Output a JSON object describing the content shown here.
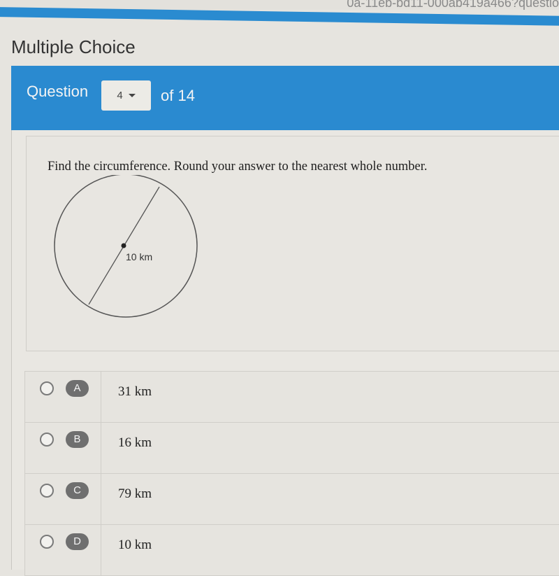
{
  "browser": {
    "url_fragment": "0a-11eb-bd11-000ab419a466?questio"
  },
  "page": {
    "title": "Multiple Choice"
  },
  "question_nav": {
    "label": "Question",
    "current": "4",
    "total_text": "of 14"
  },
  "question": {
    "prompt": "Find the circumference. Round your answer to the nearest whole number.",
    "figure": {
      "shape": "circle",
      "segment": "diameter",
      "label": "10 km"
    }
  },
  "choices": [
    {
      "letter": "A",
      "text": "31 km"
    },
    {
      "letter": "B",
      "text": "16 km"
    },
    {
      "letter": "C",
      "text": "79 km"
    },
    {
      "letter": "D",
      "text": "10 km"
    }
  ],
  "colors": {
    "header_blue": "#2a8ad0",
    "badge_gray": "#6f6f6f"
  }
}
